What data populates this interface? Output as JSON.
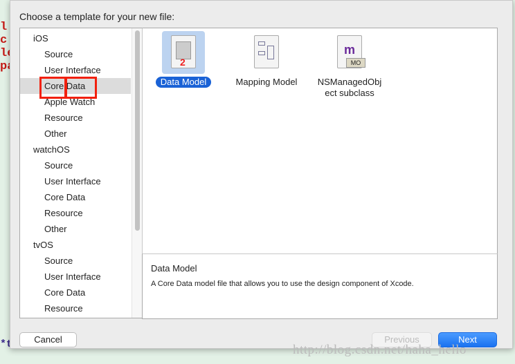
{
  "dialog_title": "Choose a template for your new file:",
  "sidebar": [
    {
      "label": "iOS",
      "type": "header"
    },
    {
      "label": "Source",
      "type": "item"
    },
    {
      "label": "User Interface",
      "type": "item"
    },
    {
      "label": "Core Data",
      "type": "item",
      "selected": true
    },
    {
      "label": "Apple Watch",
      "type": "item"
    },
    {
      "label": "Resource",
      "type": "item"
    },
    {
      "label": "Other",
      "type": "item"
    },
    {
      "label": "watchOS",
      "type": "header"
    },
    {
      "label": "Source",
      "type": "item"
    },
    {
      "label": "User Interface",
      "type": "item"
    },
    {
      "label": "Core Data",
      "type": "item"
    },
    {
      "label": "Resource",
      "type": "item"
    },
    {
      "label": "Other",
      "type": "item"
    },
    {
      "label": "tvOS",
      "type": "header"
    },
    {
      "label": "Source",
      "type": "item"
    },
    {
      "label": "User Interface",
      "type": "item"
    },
    {
      "label": "Core Data",
      "type": "item"
    },
    {
      "label": "Resource",
      "type": "item"
    }
  ],
  "templates": [
    {
      "label": "Data Model",
      "icon": "data-model-icon",
      "selected": true
    },
    {
      "label": "Mapping Model",
      "icon": "mapping-model-icon"
    },
    {
      "label": "NSManagedObject subclass",
      "line1": "NSManagedObj",
      "line2": "ect subclass",
      "icon": "managed-object-icon",
      "badge": "MO",
      "glyph": "m"
    }
  ],
  "description": {
    "title": "Data Model",
    "text": "A Core Data model file that allows you to use the design component of Xcode."
  },
  "buttons": {
    "cancel": "Cancel",
    "previous": "Previous",
    "next": "Next"
  },
  "watermark": "http://blog.csdn.net/haha_hello",
  "colors": {
    "accent": "#1a62d6",
    "highlight_box": "#f2200d",
    "next_button": "#1f7cf5"
  }
}
